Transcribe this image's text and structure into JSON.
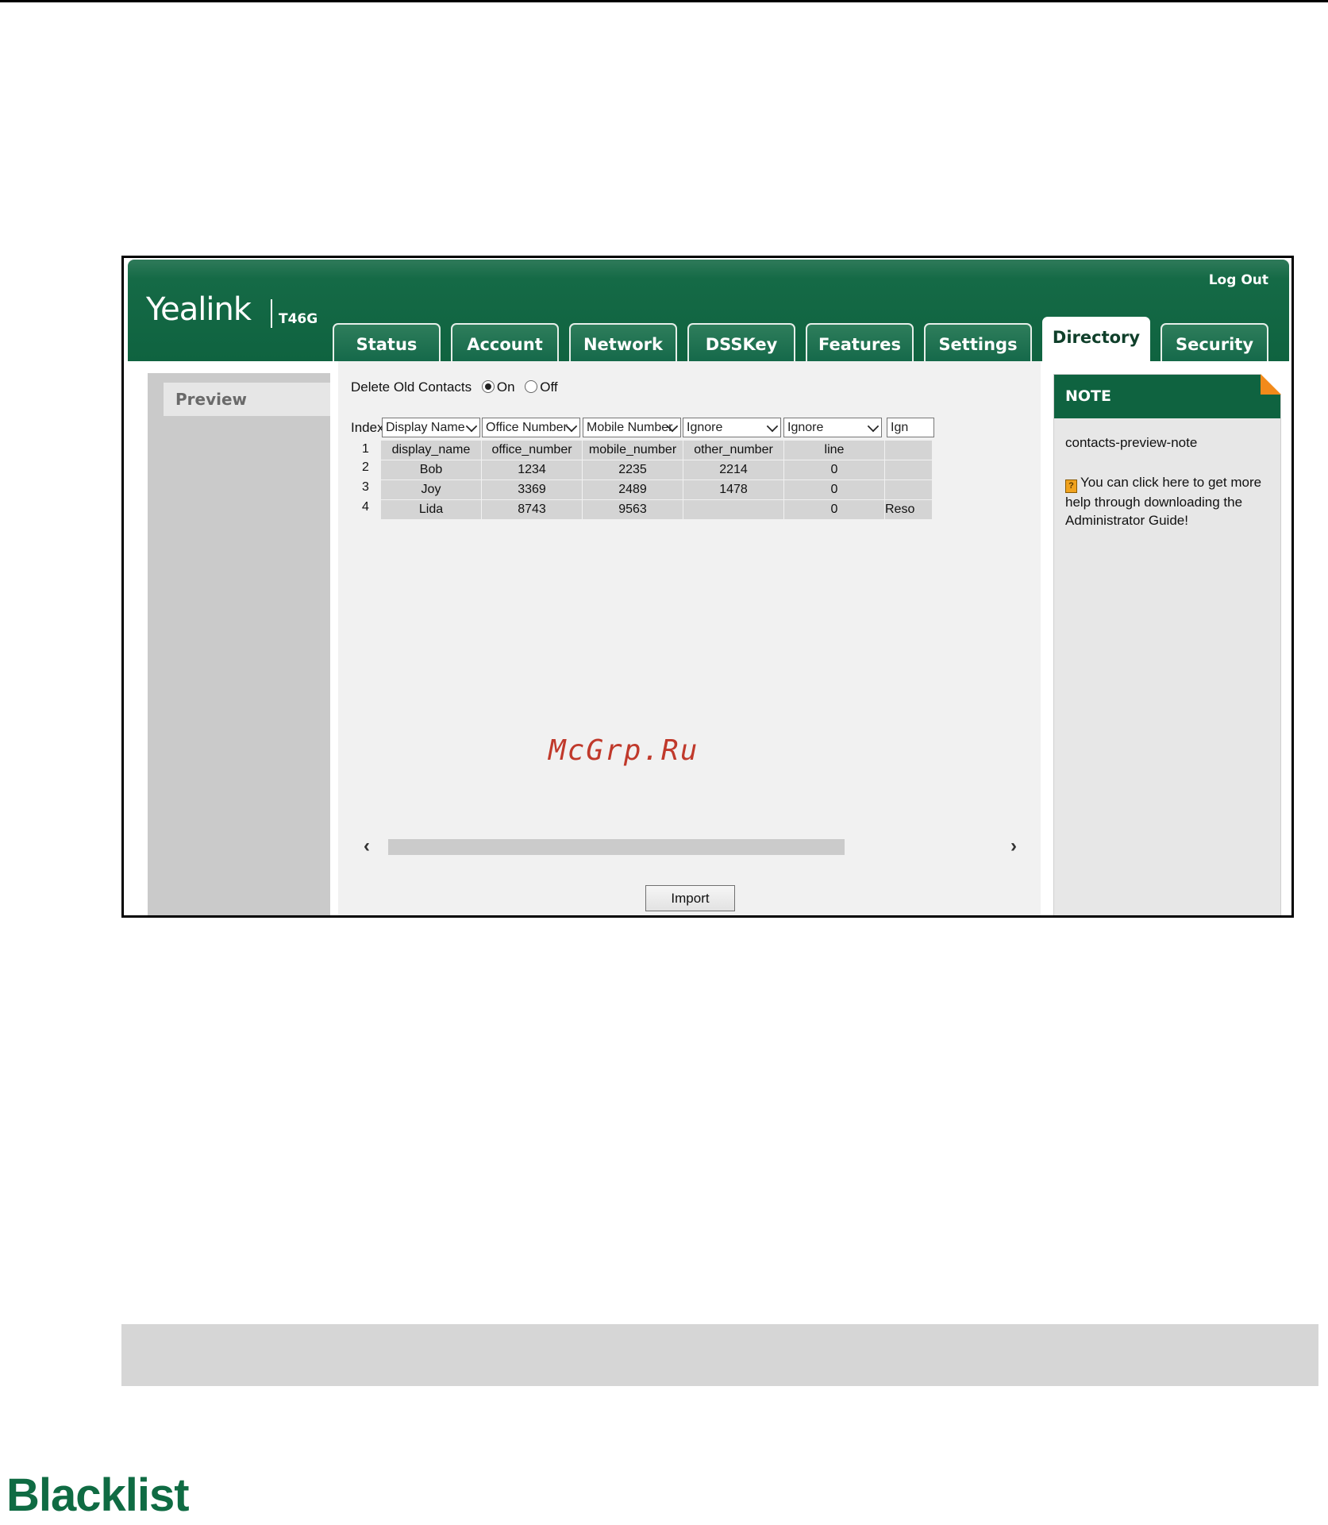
{
  "header": {
    "logo": "Yealink",
    "model": "T46G",
    "logout": "Log Out"
  },
  "tabs": [
    {
      "label": "Status"
    },
    {
      "label": "Account"
    },
    {
      "label": "Network"
    },
    {
      "label": "DSSKey"
    },
    {
      "label": "Features"
    },
    {
      "label": "Settings"
    },
    {
      "label": "Directory",
      "active": true
    },
    {
      "label": "Security"
    }
  ],
  "sidebar": {
    "items": [
      {
        "label": "Preview"
      }
    ]
  },
  "main": {
    "delete_old_contacts": {
      "label": "Delete Old Contacts",
      "on_label": "On",
      "off_label": "Off",
      "selected": "On"
    },
    "grid": {
      "index_label": "Index",
      "column_selects": [
        "Display Name",
        "Office Number",
        "Mobile Number",
        "Ignore",
        "Ignore",
        "Ign"
      ],
      "rows": [
        {
          "index": "1",
          "cells": [
            "display_name",
            "office_number",
            "mobile_number",
            "other_number",
            "line",
            ""
          ]
        },
        {
          "index": "2",
          "cells": [
            "Bob",
            "1234",
            "2235",
            "2214",
            "0",
            ""
          ]
        },
        {
          "index": "3",
          "cells": [
            "Joy",
            "3369",
            "2489",
            "1478",
            "0",
            ""
          ]
        },
        {
          "index": "4",
          "cells": [
            "Lida",
            "8743",
            "9563",
            "",
            "0",
            "Reso"
          ]
        }
      ]
    },
    "import_label": "Import"
  },
  "watermark": "McGrp.Ru",
  "note": {
    "title": "NOTE",
    "text": "contacts-preview-note",
    "help_text": "You can click here to get more help through downloading the Administrator Guide!"
  },
  "section_title": "Blacklist",
  "colors": {
    "brand_green": "#0f6340",
    "note_corner": "#f28a1a",
    "section_title": "#0f6b43"
  }
}
